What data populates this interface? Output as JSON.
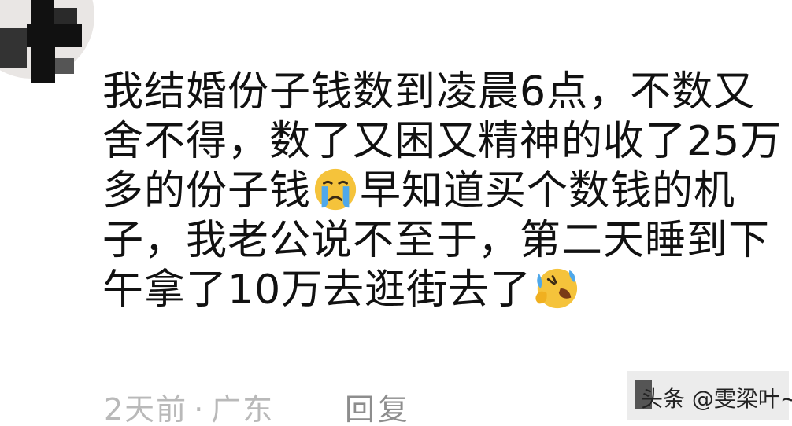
{
  "comment": {
    "lines": {
      "l1": "我结婚份子钱数到凌晨6点，不数又",
      "l2": "舍不得，数了又困又精神的收了25万",
      "l3a": "多的份子钱",
      "l3b": "早知道买个数钱的机",
      "l4": "子，我老公说不至于，第二天睡到下",
      "l5": "午拿了10万去逛街去了"
    },
    "emojis": [
      "crying-face-icon",
      "rolling-on-floor-laughing-icon"
    ]
  },
  "meta": {
    "time": "2天前",
    "separator": "·",
    "location": "广东",
    "reply_label": "回复"
  },
  "watermark": {
    "text": "头条 @雯梁叶~"
  },
  "colors": {
    "text": "#111111",
    "meta": "#b9b9b9",
    "reply": "#8d8d8d",
    "emoji_face": "#f5c33b",
    "emoji_tears": "#4fa8ea"
  }
}
